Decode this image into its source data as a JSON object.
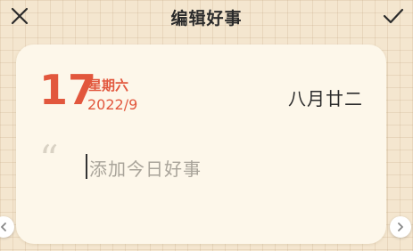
{
  "header": {
    "title": "编辑好事",
    "close_icon": "close-icon",
    "confirm_icon": "checkmark-icon"
  },
  "card": {
    "day": "17",
    "weekday": "星期六",
    "year_month": "2022/9",
    "lunar_date": "八月廿二",
    "quote_mark": "“",
    "placeholder": "添加今日好事"
  },
  "nav": {
    "prev_icon": "chevron-left-icon",
    "next_icon": "chevron-right-icon"
  },
  "colors": {
    "accent": "#e2573d",
    "background": "#f4e6cf",
    "card": "#fdf7ea"
  }
}
